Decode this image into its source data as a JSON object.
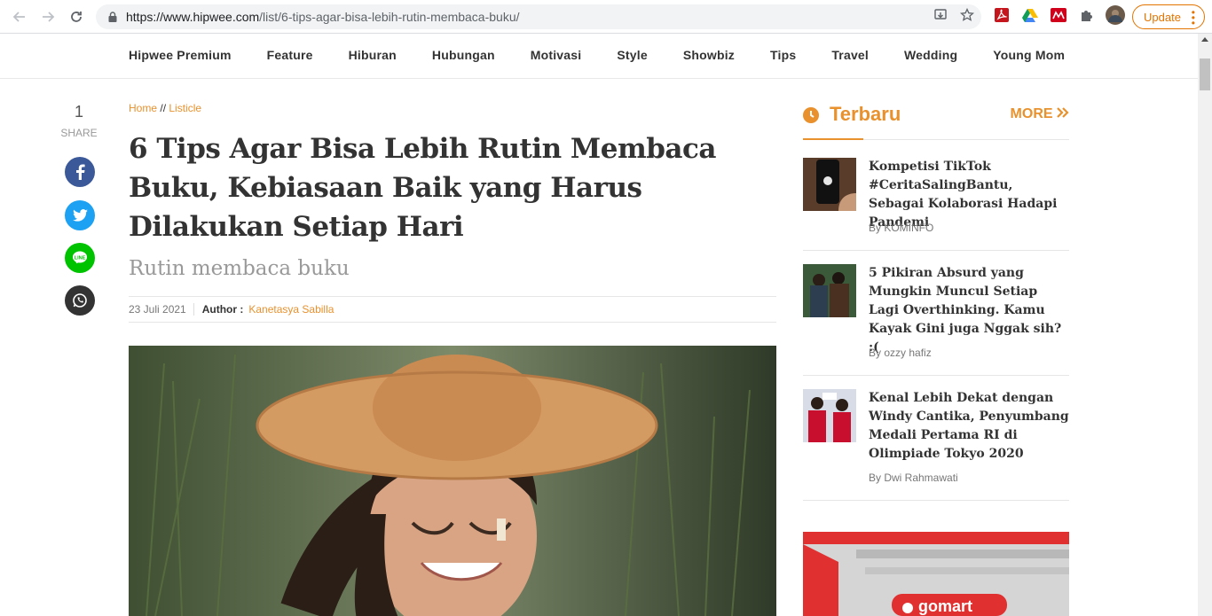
{
  "browser": {
    "url_host": "https://www.hipwee.com",
    "url_path": "/list/6-tips-agar-bisa-lebih-rutin-membaca-buku/",
    "update_label": "Update"
  },
  "nav": {
    "items": [
      "Hipwee Premium",
      "Feature",
      "Hiburan",
      "Hubungan",
      "Motivasi",
      "Style",
      "Showbiz",
      "Tips",
      "Travel",
      "Wedding",
      "Young Mom"
    ]
  },
  "share": {
    "count": "1",
    "label": "SHARE"
  },
  "article": {
    "breadcrumb_home": "Home",
    "breadcrumb_sep": "//",
    "breadcrumb_section": "Listicle",
    "title": "6 Tips Agar Bisa Lebih Rutin Membaca Buku, Kebiasaan Baik yang Harus Dilakukan Setiap Hari",
    "subtitle": "Rutin membaca buku",
    "date": "23 Juli 2021",
    "author_label": "Author :",
    "author_name": "Kanetasya Sabilla"
  },
  "sidebar": {
    "heading": "Terbaru",
    "more": "MORE",
    "posts": [
      {
        "title": "Kompetisi TikTok #CeritaSalingBantu, Sebagai Kolaborasi Hadapi Pandemi",
        "by": "By KOMINFO"
      },
      {
        "title": "5 Pikiran Absurd yang Mungkin Muncul Setiap Lagi Overthinking. Kamu Kayak Gini juga Nggak sih? :(",
        "by": "By ozzy hafiz"
      },
      {
        "title": "Kenal Lebih Dekat dengan Windy Cantika, Penyumbang Medali Pertama RI di Olimpiade Tokyo 2020",
        "by": "By Dwi Rahmawati"
      }
    ],
    "ad_brand": "gomart"
  },
  "colors": {
    "accent": "#e8912d",
    "facebook": "#3b5998",
    "twitter": "#1da1f2",
    "line": "#00c300",
    "whatsapp": "#333333"
  }
}
